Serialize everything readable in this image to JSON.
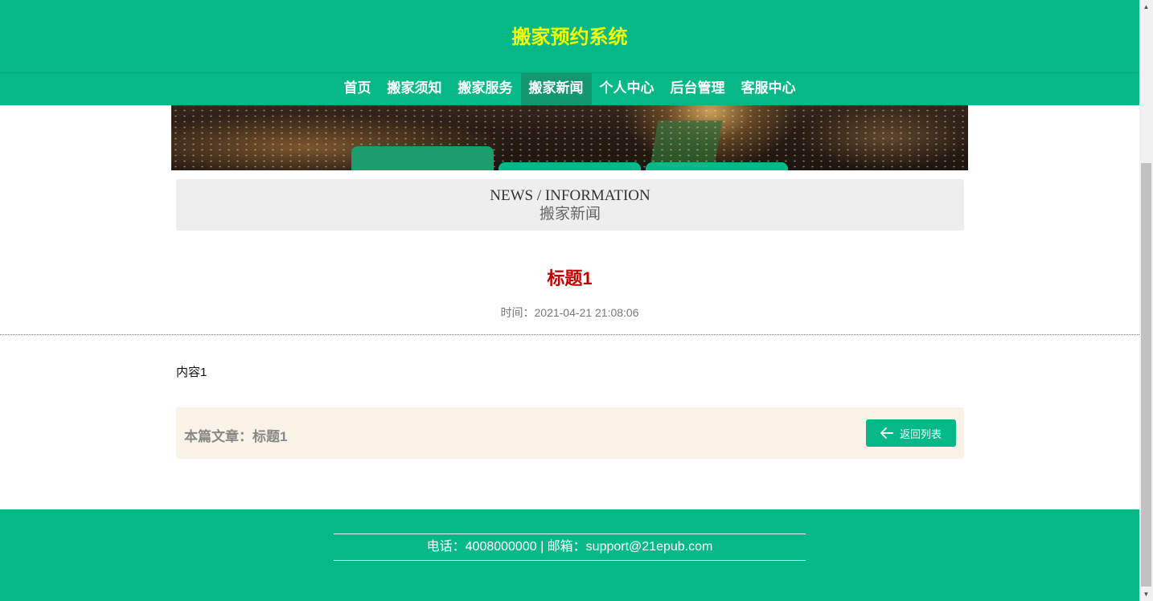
{
  "header": {
    "site_title": "搬家预约系统",
    "nav": [
      {
        "label": "首页"
      },
      {
        "label": "搬家须知"
      },
      {
        "label": "搬家服务"
      },
      {
        "label": "搬家新闻",
        "active": true
      },
      {
        "label": "个人中心"
      },
      {
        "label": "后台管理"
      },
      {
        "label": "客服中心"
      }
    ]
  },
  "section": {
    "title_en": "NEWS / INFORMATION",
    "title_cn": "搬家新闻"
  },
  "article": {
    "title": "标题1",
    "time_label": "时间：",
    "time_value": "2021-04-21 21:08:06",
    "content": "内容1"
  },
  "article_footer": {
    "current_label": "本篇文章：",
    "current_title": "标题1",
    "back_label": "返回列表",
    "back_icon": "arrow-left-icon"
  },
  "site_footer": {
    "contact": "电话：4008000000 | 邮箱：support@21epub.com"
  },
  "colors": {
    "primary": "#05b888",
    "title_yellow": "#f7ff00",
    "article_red": "#c00000",
    "nav_active": "#139771"
  }
}
